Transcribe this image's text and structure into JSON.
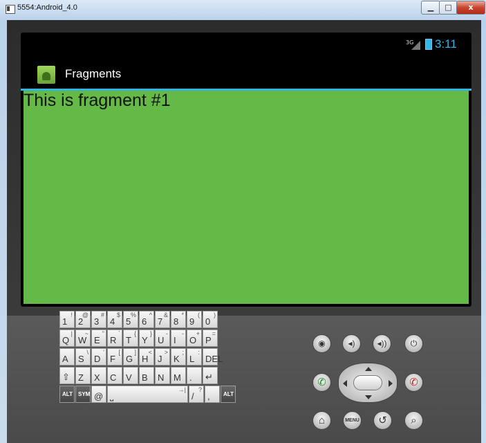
{
  "window": {
    "title": "5554:Android_4.0",
    "minimize": "▁",
    "maximize": "□",
    "close": "x"
  },
  "status_bar": {
    "network": "3G",
    "time": "3:11",
    "accent_color": "#33b5e5"
  },
  "action_bar": {
    "title": "Fragments"
  },
  "content": {
    "text": "This is fragment #1",
    "background": "#65b946"
  },
  "keyboard": {
    "rows": [
      [
        {
          "m": "1",
          "a": "!"
        },
        {
          "m": "2",
          "a": "@"
        },
        {
          "m": "3",
          "a": "#"
        },
        {
          "m": "4",
          "a": "$"
        },
        {
          "m": "5",
          "a": "%"
        },
        {
          "m": "6",
          "a": "^"
        },
        {
          "m": "7",
          "a": "&"
        },
        {
          "m": "8",
          "a": "*"
        },
        {
          "m": "9",
          "a": "("
        },
        {
          "m": "0",
          "a": ")"
        }
      ],
      [
        {
          "m": "Q",
          "a": "|"
        },
        {
          "m": "W",
          "a": "~"
        },
        {
          "m": "E",
          "a": "\""
        },
        {
          "m": "R",
          "a": "`"
        },
        {
          "m": "T",
          "a": "{"
        },
        {
          "m": "Y",
          "a": "}"
        },
        {
          "m": "U",
          "a": "-"
        },
        {
          "m": "I",
          "a": "-"
        },
        {
          "m": "O",
          "a": "+"
        },
        {
          "m": "P",
          "a": "="
        }
      ],
      [
        {
          "m": "A",
          "a": ""
        },
        {
          "m": "S",
          "a": "\\"
        },
        {
          "m": "D",
          "a": "'"
        },
        {
          "m": "F",
          "a": "["
        },
        {
          "m": "G",
          "a": "]"
        },
        {
          "m": "H",
          "a": "<"
        },
        {
          "m": "J",
          "a": ">"
        },
        {
          "m": "K",
          "a": ";"
        },
        {
          "m": "L",
          "a": ":"
        },
        {
          "m": "DEL",
          "a": ""
        }
      ],
      [
        {
          "m": "⇧",
          "a": ""
        },
        {
          "m": "Z",
          "a": ""
        },
        {
          "m": "X",
          "a": ""
        },
        {
          "m": "C",
          "a": ""
        },
        {
          "m": "V",
          "a": ""
        },
        {
          "m": "B",
          "a": ""
        },
        {
          "m": "N",
          "a": ""
        },
        {
          "m": "M",
          "a": ""
        },
        {
          "m": ".",
          "a": ""
        },
        {
          "m": "↵",
          "a": ""
        }
      ],
      [
        {
          "m": "ALT",
          "a": ""
        },
        {
          "m": "SYM",
          "a": ""
        },
        {
          "m": "@",
          "a": ""
        },
        {
          "m": "⎵",
          "a": "→|"
        },
        {
          "m": "/",
          "a": "?"
        },
        {
          "m": ",",
          "a": ""
        },
        {
          "m": "ALT",
          "a": ""
        }
      ]
    ]
  },
  "hardware_buttons": {
    "camera": "◉",
    "volume_down": "◂)",
    "volume_up": "◂))",
    "power": "⏻",
    "call": "✆",
    "end_call": "✆",
    "home": "⌂",
    "menu": "MENU",
    "back": "↺",
    "search": "⌕"
  }
}
